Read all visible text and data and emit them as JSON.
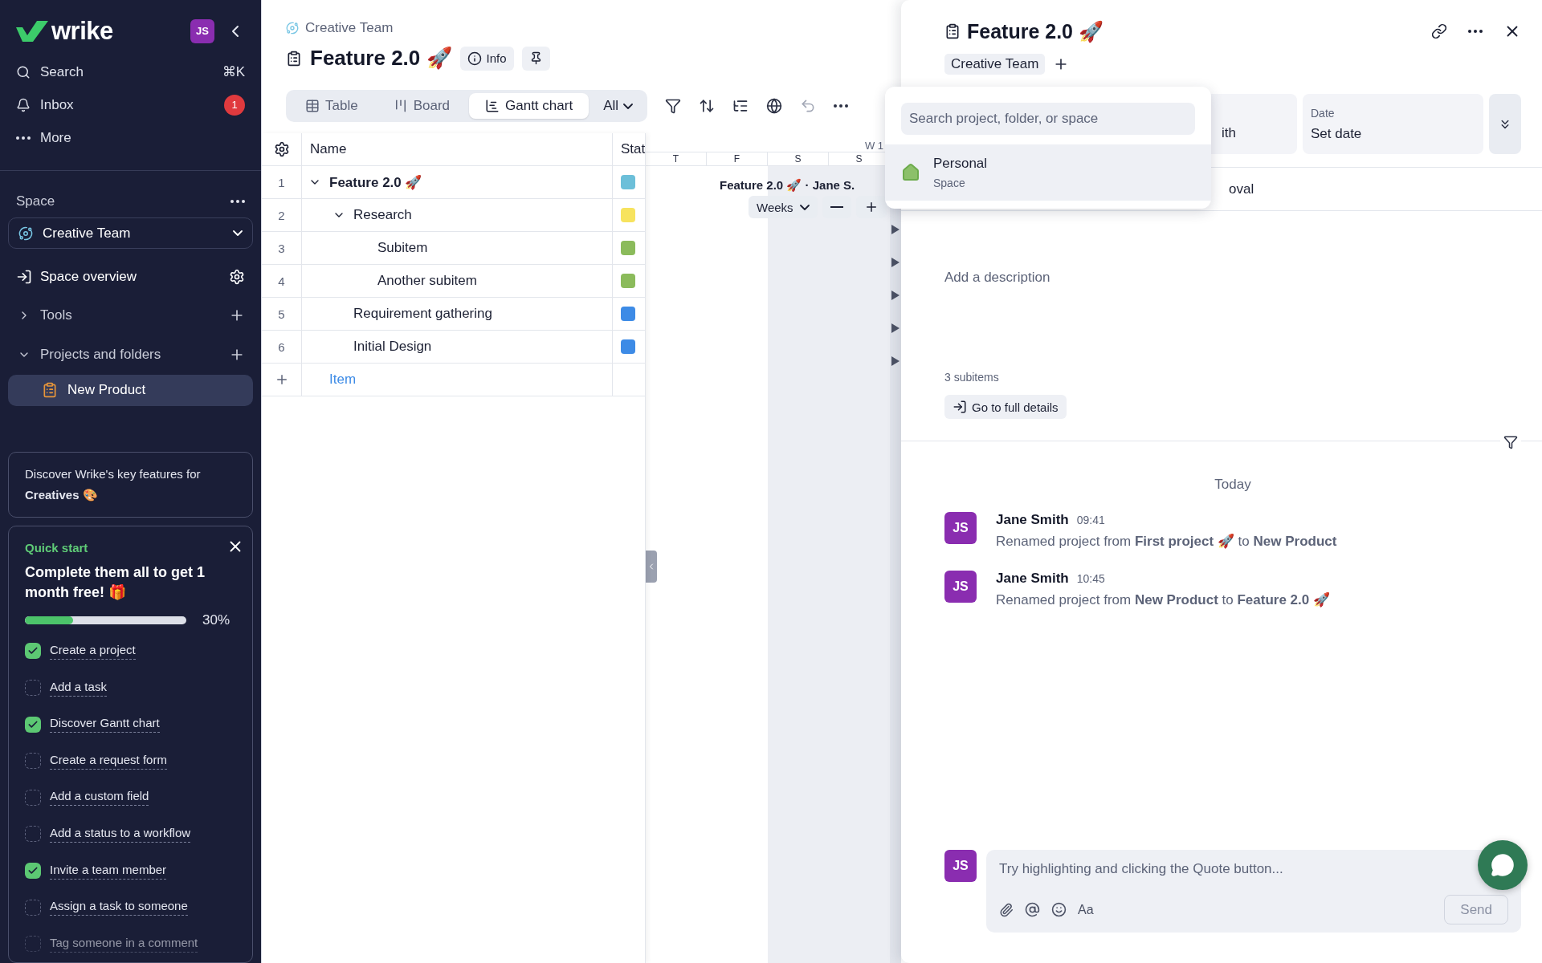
{
  "sidebar": {
    "logo": "wrike",
    "avatar": "JS",
    "nav": [
      {
        "kind": "search",
        "label": "Search",
        "shortcut": "⌘K"
      },
      {
        "kind": "inbox",
        "label": "Inbox",
        "badge": "1"
      },
      {
        "kind": "more",
        "label": "More"
      }
    ],
    "space_label": "Space",
    "space_select": "Creative Team",
    "items": [
      {
        "kind": "overview",
        "label": "Space overview"
      },
      {
        "kind": "tools",
        "label": "Tools",
        "expanded": false
      },
      {
        "kind": "projects",
        "label": "Projects and folders",
        "expanded": true
      }
    ],
    "projects": [
      {
        "label": "New Product",
        "selected": true
      }
    ],
    "promo": "Discover Wrike's key features for **Creatives** 🎨",
    "quick_start": {
      "eyebrow": "Quick start",
      "title": "Complete them all to get 1 month free! 🎁",
      "level": 0.3,
      "percent": "30%",
      "tasks": [
        {
          "label": "Create a project",
          "checked": true
        },
        {
          "label": "Add a task",
          "checked": false
        },
        {
          "label": "Discover Gantt chart",
          "checked": true
        },
        {
          "label": "Create a request form",
          "checked": false
        },
        {
          "label": "Add a custom field",
          "checked": false
        },
        {
          "label": "Add a status to a workflow",
          "checked": false
        },
        {
          "label": "Invite a team member",
          "checked": true
        },
        {
          "label": "Assign a task to someone",
          "checked": false
        },
        {
          "label": "Tag someone in a comment",
          "checked": false
        }
      ]
    }
  },
  "main": {
    "breadcrumb": "Creative Team",
    "title": "Feature 2.0 🚀",
    "info_button": "Info",
    "views": [
      {
        "kind": "table",
        "label": "Table",
        "selected": false
      },
      {
        "kind": "board",
        "label": "Board",
        "selected": false
      },
      {
        "kind": "gantt",
        "label": "Gantt chart",
        "selected": true
      }
    ],
    "view_filter": "All",
    "toolbar": [
      {
        "kind": "filter",
        "disabled": false
      },
      {
        "kind": "sort",
        "disabled": false
      },
      {
        "kind": "group",
        "disabled": false
      },
      {
        "kind": "globe",
        "disabled": false
      },
      {
        "kind": "undo",
        "disabled": true
      },
      {
        "kind": "more",
        "disabled": false
      }
    ],
    "table": {
      "columns": [
        "Name",
        "Stat"
      ],
      "rows": [
        {
          "num": "1",
          "name": "Feature 2.0 🚀",
          "color": "#6cbfd9",
          "expanded": true,
          "children": [
            {
              "num": "2",
              "name": "Research",
              "color": "#f7e35e",
              "expanded": true,
              "children": [
                {
                  "num": "3",
                  "name": "Subitem",
                  "color": "#8bbb5b"
                },
                {
                  "num": "4",
                  "name": "Another subitem",
                  "color": "#8bbb5b"
                }
              ]
            },
            {
              "num": "5",
              "name": "Requirement gathering",
              "color": "#3d8be6"
            },
            {
              "num": "6",
              "name": "Initial Design",
              "color": "#3d8be6"
            }
          ]
        }
      ],
      "add_row": "Item"
    },
    "gantt": {
      "week": "W 1",
      "days": [
        {
          "label": "T",
          "weekend": false
        },
        {
          "label": "F",
          "weekend": false
        },
        {
          "label": "S",
          "weekend": true
        },
        {
          "label": "S",
          "weekend": true
        }
      ],
      "bar_label": "Feature 2.0 🚀 · Jane S.",
      "scale": "Weeks"
    }
  },
  "panel": {
    "title": "Feature 2.0 🚀",
    "tags": [
      "Creative Team"
    ],
    "popover": {
      "placeholder": "Search project, folder, or space",
      "options": [
        {
          "name": "Personal",
          "type": "Space",
          "selected": true
        }
      ]
    },
    "assignee_fragment": "ith",
    "date": {
      "label": "Date",
      "value": "Set date"
    },
    "status_fragment": "oval",
    "description_placeholder": "Add a description",
    "subitems": "3 subitems",
    "details_button": "Go to full details",
    "day": "Today",
    "messages": [
      {
        "avatar": "JS",
        "author": "Jane Smith",
        "time": "09:41",
        "text": "Renamed project from **First project 🚀** to **New Product**"
      },
      {
        "avatar": "JS",
        "author": "Jane Smith",
        "time": "10:45",
        "text": "Renamed project from **New Product** to **Feature 2.0 🚀**"
      }
    ],
    "composer": {
      "avatar": "JS",
      "placeholder": "Try highlighting and clicking the Quote button...",
      "format": "Aa",
      "send": "Send"
    }
  }
}
